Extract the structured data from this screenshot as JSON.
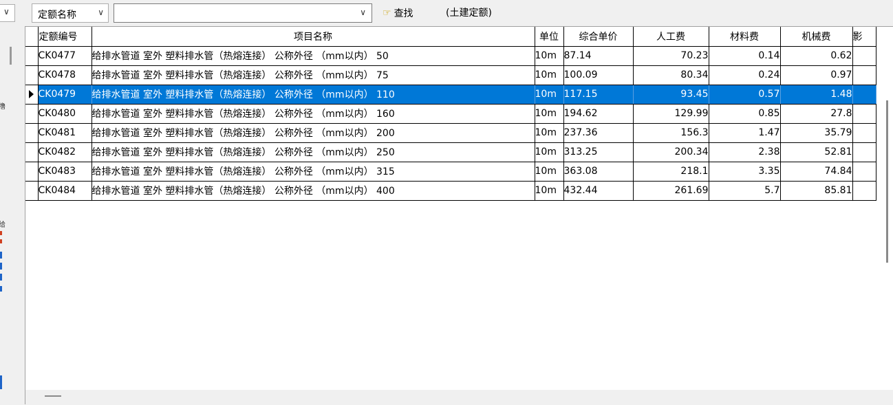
{
  "toolbar": {
    "field_select_value": "定额名称",
    "search_value": "",
    "find_label": "查找",
    "quota_type": "(土建定额)"
  },
  "left_panel": {
    "glyph_1": "撸",
    "glyph_2": "给"
  },
  "table": {
    "columns": [
      "定额编号",
      "项目名称",
      "单位",
      "综合单价",
      "人工费",
      "材料费",
      "机械费",
      "影"
    ],
    "rows": [
      {
        "code": "CK0477",
        "name": "给排水管道 室外 塑料排水管（热熔连接） 公称外径 （mm以内） 50",
        "unit": "10m",
        "price": "87.14",
        "labor": "70.23",
        "material": "0.14",
        "machine": "0.62"
      },
      {
        "code": "CK0478",
        "name": "给排水管道 室外 塑料排水管（热熔连接） 公称外径 （mm以内） 75",
        "unit": "10m",
        "price": "100.09",
        "labor": "80.34",
        "material": "0.24",
        "machine": "0.97"
      },
      {
        "code": "CK0479",
        "name": "给排水管道 室外 塑料排水管（热熔连接） 公称外径 （mm以内） 110",
        "unit": "10m",
        "price": "117.15",
        "labor": "93.45",
        "material": "0.57",
        "machine": "1.48"
      },
      {
        "code": "CK0480",
        "name": "给排水管道 室外 塑料排水管（热熔连接） 公称外径 （mm以内） 160",
        "unit": "10m",
        "price": "194.62",
        "labor": "129.99",
        "material": "0.85",
        "machine": "27.8"
      },
      {
        "code": "CK0481",
        "name": "给排水管道 室外 塑料排水管（热熔连接） 公称外径 （mm以内） 200",
        "unit": "10m",
        "price": "237.36",
        "labor": "156.3",
        "material": "1.47",
        "machine": "35.79"
      },
      {
        "code": "CK0482",
        "name": "给排水管道 室外 塑料排水管（热熔连接） 公称外径 （mm以内） 250",
        "unit": "10m",
        "price": "313.25",
        "labor": "200.34",
        "material": "2.38",
        "machine": "52.81"
      },
      {
        "code": "CK0483",
        "name": "给排水管道 室外 塑料排水管（热熔连接） 公称外径 （mm以内） 315",
        "unit": "10m",
        "price": "363.08",
        "labor": "218.1",
        "material": "3.35",
        "machine": "74.84"
      },
      {
        "code": "CK0484",
        "name": "给排水管道 室外 塑料排水管（热熔连接） 公称外径 （mm以内） 400",
        "unit": "10m",
        "price": "432.44",
        "labor": "261.69",
        "material": "5.7",
        "machine": "85.81"
      }
    ],
    "selected_index": 2
  },
  "colors": {
    "selection": "#0078d7",
    "background": "#f0f0f0",
    "grid_line": "#000000"
  }
}
